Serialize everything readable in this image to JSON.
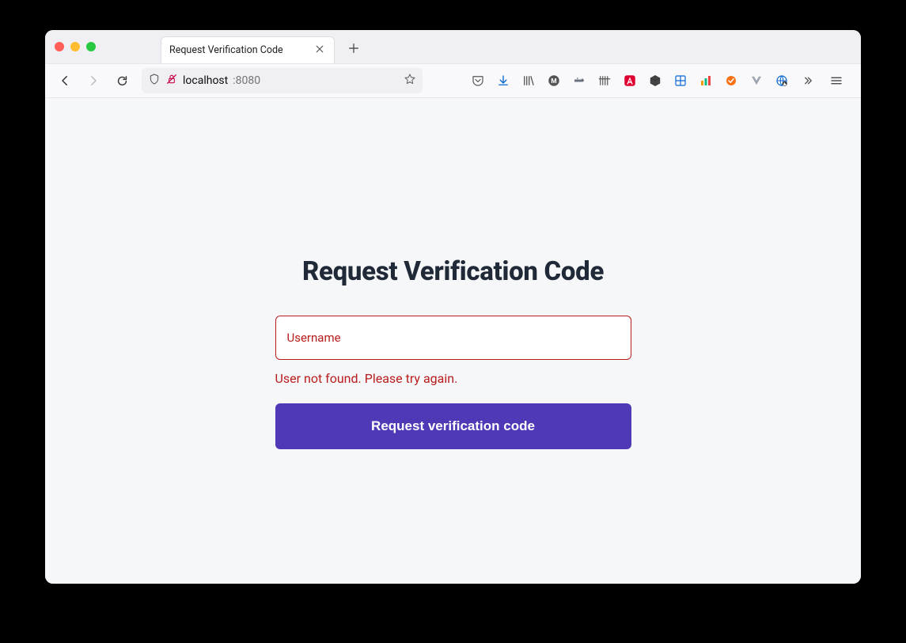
{
  "browser": {
    "tab_title": "Request Verification Code",
    "url_host": "localhost",
    "url_port": ":8080"
  },
  "page": {
    "heading": "Request Verification Code",
    "username_label": "Username",
    "error_message": "User not found. Please try again.",
    "submit_label": "Request verification code"
  }
}
